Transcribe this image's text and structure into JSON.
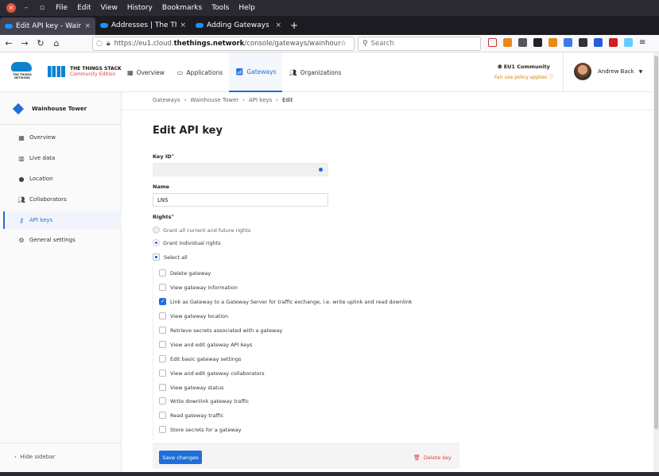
{
  "browser": {
    "menu": [
      "File",
      "Edit",
      "View",
      "History",
      "Bookmarks",
      "Tools",
      "Help"
    ],
    "tabs": [
      {
        "label": "Edit API key - Wainhouse",
        "close": "×"
      },
      {
        "label": "Addresses | The Things St",
        "close": "×"
      },
      {
        "label": "Adding Gateways | The Th",
        "close": "×"
      }
    ],
    "new_tab": "+",
    "url_prefix": "https://eu1.cloud.",
    "url_domain": "thethings.network",
    "url_suffix": "/console/gateways/wainhouse-tower/a",
    "search_placeholder": "Search"
  },
  "header": {
    "ttn_logo_text": "THE THINGS NETWORK",
    "tts_name": "THE THINGS STACK",
    "tts_edition": "Community Edition",
    "nav": [
      {
        "label": "Overview",
        "icon": "grid-icon"
      },
      {
        "label": "Applications",
        "icon": "window-icon"
      },
      {
        "label": "Gateways",
        "icon": "router-icon",
        "active": true
      },
      {
        "label": "Organizations",
        "icon": "people-icon"
      }
    ],
    "cluster": "EU1 Community",
    "fair_use": "Fair use policy applies",
    "user_name": "Andrew Back"
  },
  "sidebar": {
    "entity": "Wainhouse Tower",
    "items": [
      {
        "label": "Overview",
        "icon": "grid-icon"
      },
      {
        "label": "Live data",
        "icon": "chart-icon"
      },
      {
        "label": "Location",
        "icon": "pin-icon"
      },
      {
        "label": "Collaborators",
        "icon": "people-icon"
      },
      {
        "label": "API keys",
        "icon": "key-icon",
        "active": true
      },
      {
        "label": "General settings",
        "icon": "gear-icon"
      }
    ],
    "hide_label": "Hide sidebar"
  },
  "breadcrumb": [
    "Gateways",
    "Wainhouse Tower",
    "API keys",
    "Edit"
  ],
  "form": {
    "title": "Edit API key",
    "key_id_label": "Key ID",
    "key_id_value": "",
    "name_label": "Name",
    "name_value": "LNS",
    "rights_label": "Rights",
    "grant_all": "Grant all current and future rights",
    "grant_individual": "Grant individual rights",
    "select_all": "Select all",
    "rights": [
      {
        "label": "Delete gateway",
        "checked": false
      },
      {
        "label": "View gateway information",
        "checked": false
      },
      {
        "label": "Link as Gateway to a Gateway Server for traffic exchange, i.e. write uplink and read downlink",
        "checked": true
      },
      {
        "label": "View gateway location",
        "checked": false
      },
      {
        "label": "Retrieve secrets associated with a gateway",
        "checked": false
      },
      {
        "label": "View and edit gateway API keys",
        "checked": false
      },
      {
        "label": "Edit basic gateway settings",
        "checked": false
      },
      {
        "label": "View and edit gateway collaborators",
        "checked": false
      },
      {
        "label": "View gateway status",
        "checked": false
      },
      {
        "label": "Write downlink gateway traffic",
        "checked": false
      },
      {
        "label": "Read gateway traffic",
        "checked": false
      },
      {
        "label": "Store secrets for a gateway",
        "checked": false
      }
    ],
    "save_label": "Save changes",
    "delete_label": "Delete key"
  },
  "colors": {
    "accent": "#1e6fd9",
    "danger": "#e43d3d",
    "warning": "#c98a00"
  }
}
